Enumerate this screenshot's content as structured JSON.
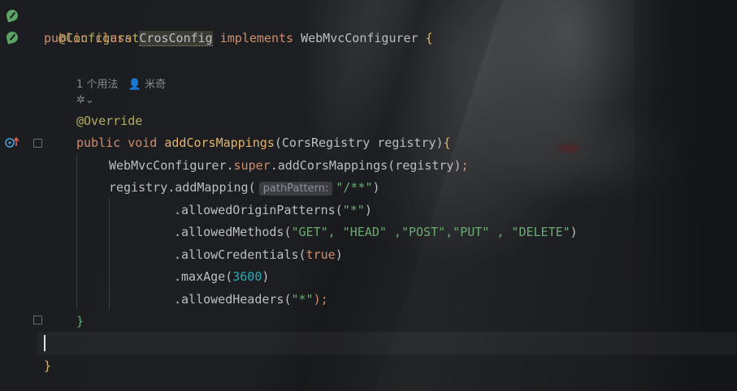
{
  "editor": {
    "lines": {
      "l1_annotation": "@Configuration",
      "l2_public": "public",
      "l2_class": "class",
      "l2_classname": "CrosConfig",
      "l2_implements": "implements",
      "l2_interface": "WebMvcConfigurer",
      "l2_brace": "{",
      "usage_count": "1 个用法",
      "author": "米奇",
      "override": "@Override",
      "m_public": "public",
      "m_void": "void",
      "m_name": "addCorsMappings",
      "m_params": "(CorsRegistry registry)",
      "m_brace": "{",
      "super_call_owner": "WebMvcConfigurer.",
      "super_kw": "super",
      "super_rest": ".addCorsMappings(registry)",
      "semicolon": ";",
      "reg_call": "registry.addMapping(",
      "param_hint": "pathPattern:",
      "reg_arg": "\"/**\"",
      "reg_close": ")",
      "chain1_method": ".allowedOriginPatterns(",
      "chain1_arg": "\"*\"",
      "chain1_close": ")",
      "chain2_method": ".allowedMethods(",
      "chain2_args": "\"GET\", \"HEAD\" ,\"POST\",\"PUT\" , \"DELETE\"",
      "chain2_close": ")",
      "chain3_method": ".allowCredentials(",
      "chain3_arg": "true",
      "chain3_close": ")",
      "chain4_method": ".maxAge(",
      "chain4_arg": "3600",
      "chain4_close": ")",
      "chain5_method": ".allowedHeaders(",
      "chain5_arg": "\"*\"",
      "chain5_close": ");",
      "method_close": "}",
      "class_close": "}"
    },
    "gutter_icons": [
      "spring-bean-icon",
      "spring-bean-icon",
      "override-method-icon",
      "fold-marker-icon"
    ]
  }
}
